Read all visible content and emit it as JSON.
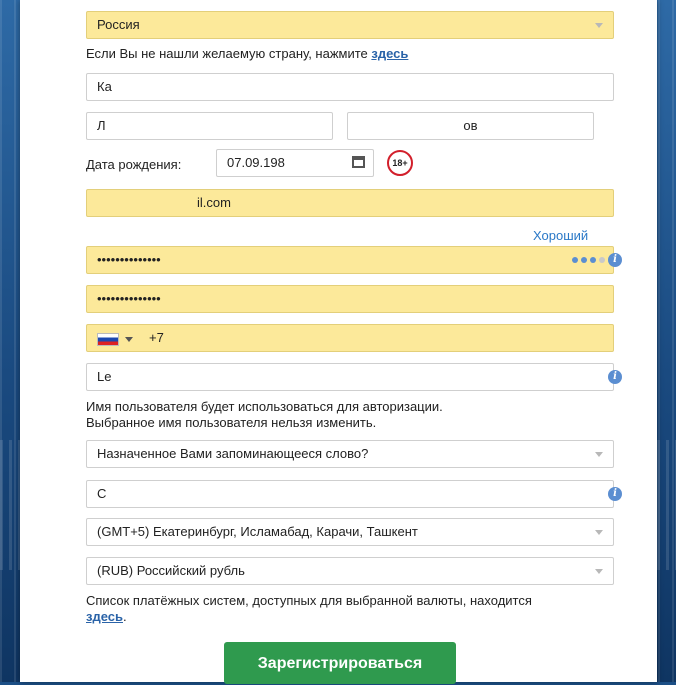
{
  "country": {
    "value": "Россия"
  },
  "country_hint": {
    "text": "Если Вы не нашли желаемую страну, нажмите ",
    "link": "здесь"
  },
  "city": {
    "value": "Ка"
  },
  "first_name": {
    "value": "Л"
  },
  "last_name": {
    "value": "ов"
  },
  "birth": {
    "label": "Дата рождения:",
    "value": "07.09.198",
    "age_badge": "18+"
  },
  "email": {
    "value": "il.com"
  },
  "password": {
    "strength": "Хороший",
    "value": "••••••••••••••",
    "repeat_value": "••••••••••••••"
  },
  "phone": {
    "code": "+7",
    "value": ""
  },
  "username": {
    "value": "Le",
    "hint_line1": "Имя пользователя будет использоваться для авторизации.",
    "hint_line2": "Выбранное имя пользователя нельзя изменить."
  },
  "secret_question": {
    "value": "Назначенное Вами запоминающееся слово?"
  },
  "secret_answer": {
    "value": "С"
  },
  "timezone": {
    "value": "(GMT+5) Екатеринбург, Исламабад, Карачи, Ташкент"
  },
  "currency": {
    "value": "(RUB) Российский рубль"
  },
  "payment_hint": {
    "text": "Список платёжных систем, доступных для выбранной валюты, находится",
    "link": "здесь",
    "tail": "."
  },
  "submit": {
    "label": "Зарегистрироваться"
  },
  "colors": {
    "highlight": "#fce99a",
    "button": "#2f9a4e",
    "link": "#2a63a8",
    "info": "#5b8ed1"
  }
}
